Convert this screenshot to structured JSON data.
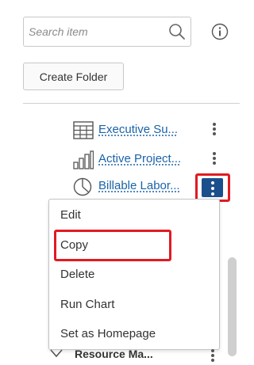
{
  "search": {
    "placeholder": "Search item",
    "value": ""
  },
  "icons": {
    "search": "search-icon",
    "info": "info-icon"
  },
  "toolbar": {
    "create_folder_label": "Create Folder"
  },
  "reports": [
    {
      "label": "Executive Su...",
      "icon": "table-report-icon"
    },
    {
      "label": "Active Project...",
      "icon": "bar-chart-report-icon"
    },
    {
      "label": "Billable Labor...",
      "icon": "pie-chart-report-icon"
    }
  ],
  "context_menu": {
    "items": [
      {
        "label": "Edit"
      },
      {
        "label": "Copy"
      },
      {
        "label": "Delete"
      },
      {
        "label": "Run Chart"
      },
      {
        "label": "Set as Homepage"
      }
    ]
  },
  "folder": {
    "label": "Resource Ma...",
    "icon": "chevron-down-icon"
  },
  "colors": {
    "link": "#1a63a8",
    "highlight": "#e01b22",
    "active_kebab_bg": "#1b4f8c"
  }
}
